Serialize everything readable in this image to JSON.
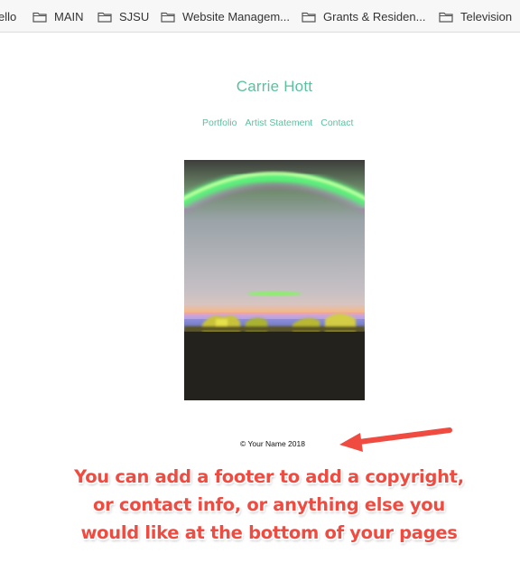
{
  "bookmarks_bar": {
    "items": [
      {
        "label": "ello",
        "icon": "none"
      },
      {
        "label": "MAIN",
        "icon": "folder-icon"
      },
      {
        "label": "SJSU",
        "icon": "folder-icon"
      },
      {
        "label": "Website Managem...",
        "icon": "folder-icon"
      },
      {
        "label": "Grants & Residen...",
        "icon": "folder-icon"
      },
      {
        "label": "Television",
        "icon": "folder-icon"
      }
    ]
  },
  "site": {
    "title": "Carrie Hott",
    "nav": [
      "Portfolio",
      "Artist Statement",
      "Contact"
    ],
    "footer": "© Your Name 2018"
  },
  "annotation": {
    "lines": [
      "You can add a footer to add a copyright,",
      "or contact info, or anything else you",
      "would like at the bottom of your pages"
    ],
    "color": "#f04b41"
  },
  "colors": {
    "accent": "#5dbf9f"
  }
}
